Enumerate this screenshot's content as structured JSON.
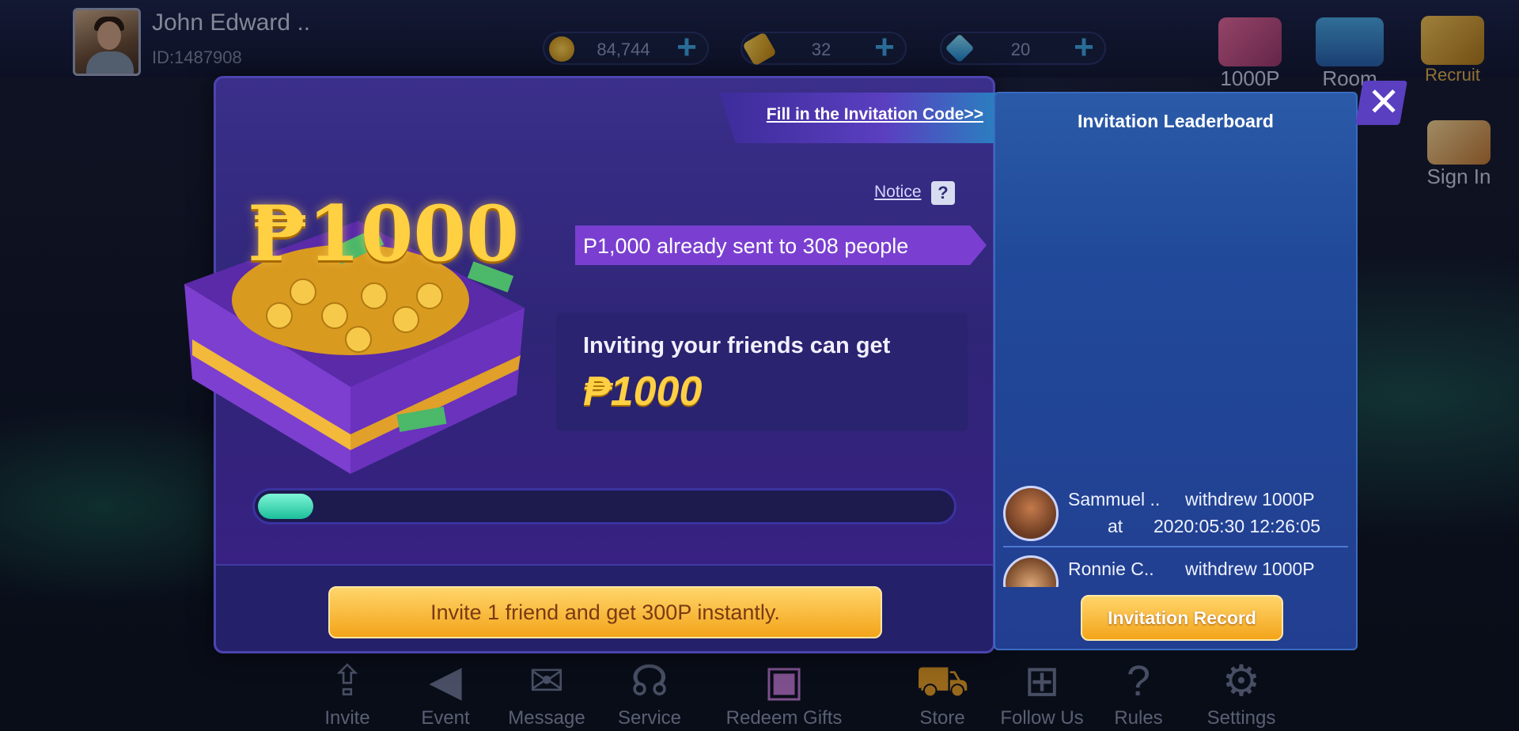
{
  "user": {
    "name": "John Edward ..",
    "id": "ID:1487908"
  },
  "currencies": [
    {
      "name": "coins",
      "value": "84,744",
      "icon": "coin-icon",
      "color": "#f0b52a"
    },
    {
      "name": "tickets",
      "value": "32",
      "icon": "ticket-icon",
      "color": "#e8b22a"
    },
    {
      "name": "diamonds",
      "value": "20",
      "icon": "diamond-icon",
      "color": "#3fb7f0"
    }
  ],
  "top_icons": {
    "p1000": "1000P",
    "room": "Room",
    "recruit": "Recruit",
    "signin": "Sign In"
  },
  "bottom_nav": {
    "invite": "Invite",
    "event": "Event",
    "message": "Message",
    "service": "Service",
    "redeem": "Redeem Gifts",
    "store": "Store",
    "follow": "Follow Us",
    "rules": "Rules",
    "settings": "Settings"
  },
  "invite_modal": {
    "hero_amount": "₱1000",
    "fill_code_link": "Fill in the Invitation Code>>",
    "notice": "Notice",
    "notice_icon": "question-icon",
    "sent_banner": "P1,000 already sent to 308 people",
    "inviting_text": "Inviting your friends can get",
    "reward": "₱1000",
    "progress": 0.08,
    "cta": "Invite 1 friend and get 300P instantly."
  },
  "leaderboard": {
    "title": "Invitation Leaderboard",
    "entries": [
      {
        "name": "Sammuel ..",
        "action": "withdrew 1000P",
        "at": "at",
        "time": "2020:05:30 12:26:05"
      },
      {
        "name": "Ronnie C..",
        "action": "withdrew 1000P"
      }
    ],
    "record_button": "Invitation Record"
  },
  "close_label": "✕"
}
